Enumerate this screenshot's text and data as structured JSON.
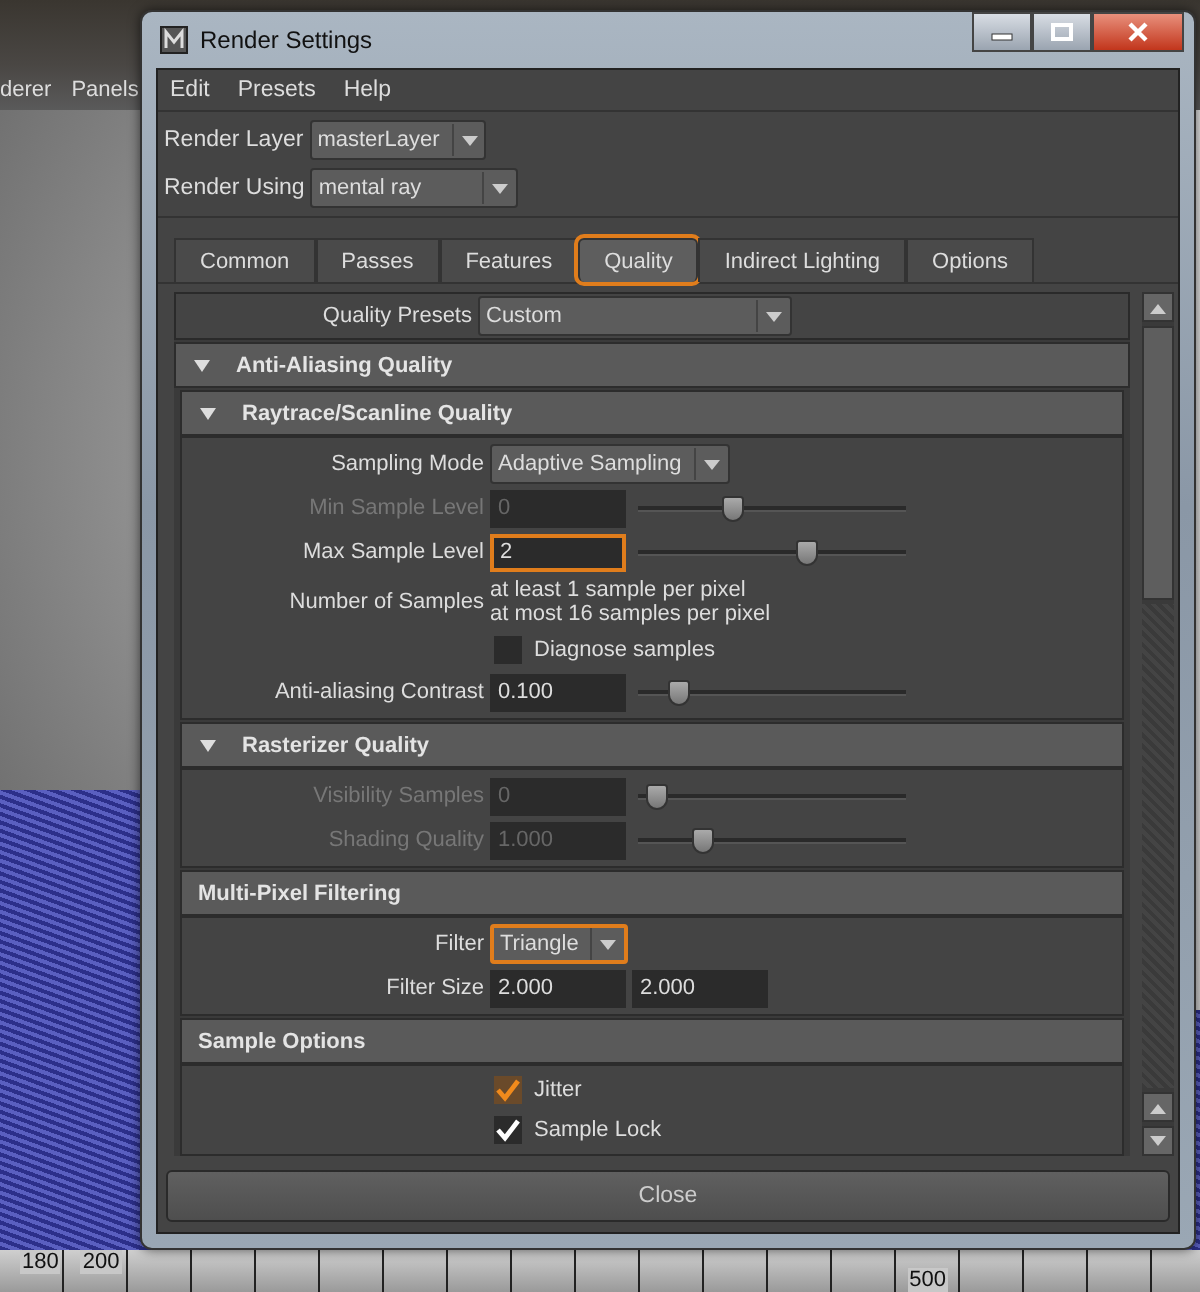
{
  "viewport": {
    "menu": [
      "derer",
      "Panels"
    ],
    "timeline": [
      "180",
      "200",
      "500"
    ]
  },
  "window": {
    "title": "Render Settings",
    "menu": [
      "Edit",
      "Presets",
      "Help"
    ],
    "render_layer": {
      "label": "Render Layer",
      "value": "masterLayer"
    },
    "render_using": {
      "label": "Render Using",
      "value": "mental ray"
    },
    "tabs": [
      {
        "label": "Common",
        "selected": false,
        "highlighted": false
      },
      {
        "label": "Passes",
        "selected": false,
        "highlighted": false
      },
      {
        "label": "Features",
        "selected": false,
        "highlighted": false
      },
      {
        "label": "Quality",
        "selected": true,
        "highlighted": true
      },
      {
        "label": "Indirect Lighting",
        "selected": false,
        "highlighted": false
      },
      {
        "label": "Options",
        "selected": false,
        "highlighted": false
      }
    ],
    "quality_presets": {
      "label": "Quality Presets",
      "value": "Custom"
    },
    "sections": [
      {
        "title": "Anti-Aliasing Quality",
        "kind": "collapsible",
        "expanded": true,
        "children": [
          {
            "title": "Raytrace/Scanline Quality",
            "kind": "collapsible",
            "expanded": true,
            "rows": [
              {
                "kind": "dropdown",
                "label": "Sampling Mode",
                "value": "Adaptive Sampling",
                "disabled": false,
                "highlighted": false
              },
              {
                "kind": "slider",
                "label": "Min Sample Level",
                "value": "0",
                "level": 0.34,
                "disabled": true,
                "highlighted": false
              },
              {
                "kind": "slider",
                "label": "Max Sample Level",
                "value": "2",
                "level": 0.64,
                "disabled": false,
                "highlighted": true
              },
              {
                "kind": "info",
                "label": "Number of Samples",
                "lines": [
                  "at least 1 sample per pixel",
                  "at most 16 samples per pixel"
                ]
              },
              {
                "kind": "checkbox",
                "label": "Diagnose samples",
                "checked": false,
                "highlighted": false
              },
              {
                "kind": "slider",
                "label": "Anti-aliasing Contrast",
                "value": "0.100",
                "level": 0.12,
                "disabled": false,
                "highlighted": false
              }
            ]
          },
          {
            "title": "Rasterizer Quality",
            "kind": "collapsible",
            "expanded": true,
            "rows": [
              {
                "kind": "slider",
                "label": "Visibility Samples",
                "value": "0",
                "level": 0.03,
                "disabled": true,
                "highlighted": false
              },
              {
                "kind": "slider",
                "label": "Shading Quality",
                "value": "1.000",
                "level": 0.22,
                "disabled": true,
                "highlighted": false
              }
            ]
          },
          {
            "title": "Multi-Pixel Filtering",
            "kind": "plain",
            "expanded": true,
            "rows": [
              {
                "kind": "dropdown",
                "label": "Filter",
                "value": "Triangle",
                "disabled": false,
                "highlighted": true
              },
              {
                "kind": "pair",
                "label": "Filter Size",
                "values": [
                  "2.000",
                  "2.000"
                ]
              }
            ]
          },
          {
            "title": "Sample Options",
            "kind": "plain",
            "expanded": true,
            "rows": [
              {
                "kind": "checkbox",
                "label": "Jitter",
                "checked": true,
                "highlighted": true
              },
              {
                "kind": "checkbox",
                "label": "Sample Lock",
                "checked": true,
                "highlighted": false
              }
            ]
          }
        ]
      }
    ],
    "close_button": "Close"
  }
}
